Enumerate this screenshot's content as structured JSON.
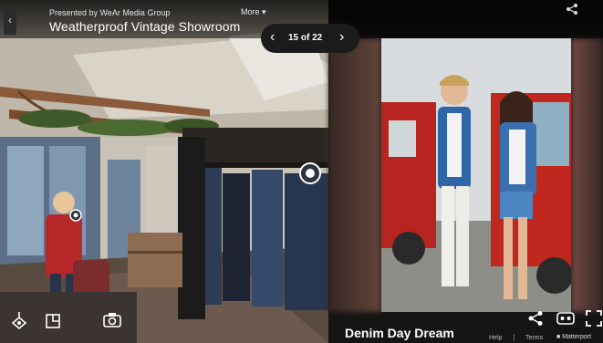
{
  "header": {
    "presented_by": "Presented by WeAr Media Group",
    "title": "Weatherproof Vintage Showroom",
    "more_label": "More"
  },
  "pager": {
    "count": "15 of 22"
  },
  "media": {
    "caption": "Denim Day Dream"
  },
  "footer": {
    "help": "Help",
    "terms": "Terms",
    "brand": "Matterport"
  },
  "colors": {
    "accent": "#ffffff",
    "bar": "#1b1b1b"
  },
  "icons": {
    "back": "chevron-left-icon",
    "more": "chevron-down-icon",
    "share": "share-icon",
    "prev": "chevron-left-icon",
    "next": "chevron-right-icon",
    "dollhouse": "dollhouse-icon",
    "floorplan": "floorplan-icon",
    "camera": "camera-icon",
    "vr": "vr-icon",
    "fullscreen": "fullscreen-icon"
  }
}
